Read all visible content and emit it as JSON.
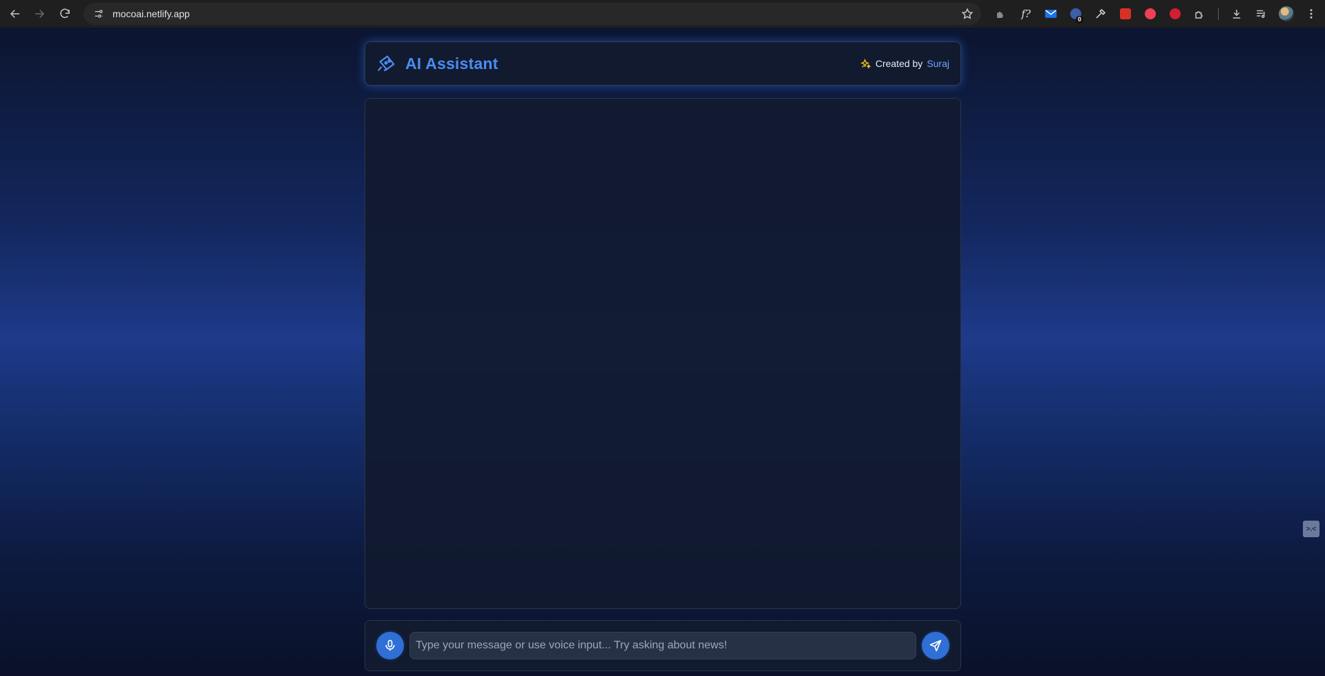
{
  "browser": {
    "url": "mocoai.netlify.app",
    "extension_badge": "0"
  },
  "header": {
    "title": "AI Assistant",
    "credit_prefix": "Created by",
    "credit_author": "Suraj"
  },
  "composer": {
    "placeholder": "Type your message or use voice input... Try asking about news!"
  },
  "side_widget": {
    "label": ">.<"
  },
  "colors": {
    "accent": "#4a8cf0",
    "button": "#2f6fd6",
    "panel": "#111a2e",
    "spark": "#f5c518"
  }
}
